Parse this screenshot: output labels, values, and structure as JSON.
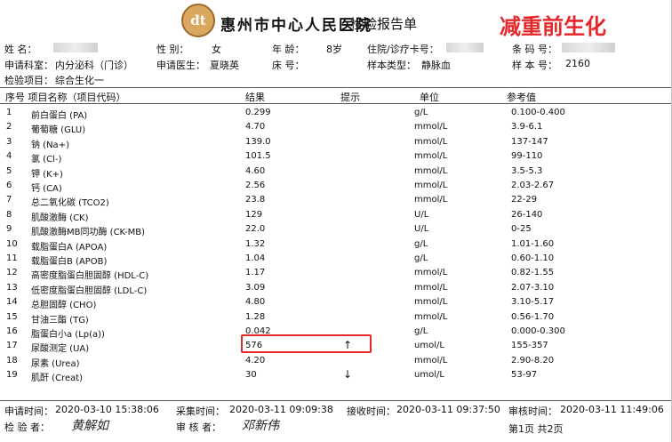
{
  "header": {
    "logo_text": "dt",
    "hospital": "惠州市中心人民医院",
    "report_type": "检验报告单",
    "tag": "减重前生化"
  },
  "patient": {
    "name_label": "姓    名：",
    "sex_label": "性    别：",
    "sex": "女",
    "age_label": "年    龄：",
    "age": "8岁",
    "admission_label": "住院/诊疗卡号：",
    "barcode_label": "条 码 号：",
    "department_label": "申请科室：",
    "department": "内分泌科（门诊）",
    "doctor_label": "申请医生：",
    "doctor": "夏晓英",
    "bed_label": "床    号：",
    "sample_type_label": "样本类型：",
    "sample_type": "静脉血",
    "sample_no_label": "样 本 号：",
    "sample_no": "2160",
    "test_item_label": "检验项目：",
    "test_item": "综合生化一"
  },
  "table": {
    "headers": {
      "no_name": "序号 项目名称（项目代码）",
      "result": "结果",
      "flag": "提示",
      "unit": "单位",
      "reference": "参考值"
    },
    "rows": [
      {
        "no": "1",
        "name": "前白蛋白 (PA)",
        "result": "0.299",
        "flag": "",
        "unit": "g/L",
        "ref": "0.100-0.400"
      },
      {
        "no": "2",
        "name": "葡萄糖 (GLU)",
        "result": "4.70",
        "flag": "",
        "unit": "mmol/L",
        "ref": "3.9-6.1"
      },
      {
        "no": "3",
        "name": "钠 (Na+)",
        "result": "139.0",
        "flag": "",
        "unit": "mmol/L",
        "ref": "137-147"
      },
      {
        "no": "4",
        "name": "氯 (Cl-)",
        "result": "101.5",
        "flag": "",
        "unit": "mmol/L",
        "ref": "99-110"
      },
      {
        "no": "5",
        "name": "钾 (K+)",
        "result": "4.60",
        "flag": "",
        "unit": "mmol/L",
        "ref": "3.5-5.3"
      },
      {
        "no": "6",
        "name": "钙 (CA)",
        "result": "2.56",
        "flag": "",
        "unit": "mmol/L",
        "ref": "2.03-2.67"
      },
      {
        "no": "7",
        "name": "总二氧化碳 (TCO2)",
        "result": "23.8",
        "flag": "",
        "unit": "mmol/L",
        "ref": "22-29"
      },
      {
        "no": "8",
        "name": "肌酸激酶 (CK)",
        "result": "129",
        "flag": "",
        "unit": "U/L",
        "ref": "26-140"
      },
      {
        "no": "9",
        "name": "肌酸激酶MB同功酶 (CK-MB)",
        "result": "22.0",
        "flag": "",
        "unit": "U/L",
        "ref": "0-25"
      },
      {
        "no": "10",
        "name": "载脂蛋白A (APOA)",
        "result": "1.32",
        "flag": "",
        "unit": "g/L",
        "ref": "1.01-1.60"
      },
      {
        "no": "11",
        "name": "载脂蛋白B (APOB)",
        "result": "1.04",
        "flag": "",
        "unit": "g/L",
        "ref": "0.60-1.10"
      },
      {
        "no": "12",
        "name": "高密度脂蛋白胆固醇 (HDL-C)",
        "result": "1.17",
        "flag": "",
        "unit": "mmol/L",
        "ref": "0.82-1.55"
      },
      {
        "no": "13",
        "name": "低密度脂蛋白胆固醇 (LDL-C)",
        "result": "3.09",
        "flag": "",
        "unit": "mmol/L",
        "ref": "2.07-3.10"
      },
      {
        "no": "14",
        "name": "总胆固醇 (CHO)",
        "result": "4.80",
        "flag": "",
        "unit": "mmol/L",
        "ref": "3.10-5.17"
      },
      {
        "no": "15",
        "name": "甘油三酯 (TG)",
        "result": "1.28",
        "flag": "",
        "unit": "mmol/L",
        "ref": "0.56-1.70"
      },
      {
        "no": "16",
        "name": "脂蛋白小a (Lp(a))",
        "result": "0.042",
        "flag": "",
        "unit": "g/L",
        "ref": "0.000-0.300"
      },
      {
        "no": "17",
        "name": "尿酸测定 (UA)",
        "result": "576",
        "flag": "↑",
        "unit": "umol/L",
        "ref": "155-357"
      },
      {
        "no": "18",
        "name": "尿素 (Urea)",
        "result": "4.20",
        "flag": "",
        "unit": "mmol/L",
        "ref": "2.90-8.20"
      },
      {
        "no": "19",
        "name": "肌酐 (Creat)",
        "result": "30",
        "flag": "↓",
        "unit": "umol/L",
        "ref": "53-97"
      }
    ]
  },
  "footer": {
    "apply_time_label": "申请时间：",
    "apply_time": "2020-03-10 15:38:06",
    "collect_time_label": "采集时间：",
    "collect_time": "2020-03-11 09:09:38",
    "receive_time_label": "接收时间：",
    "receive_time": "2020-03-11 09:37:50",
    "review_time_label": "审核时间：",
    "review_time": "2020-03-11 11:49:06",
    "tester_label": "检 验 者：",
    "tester_signature": "黄解如",
    "reviewer_label": "审 核 者：",
    "reviewer_signature": "邓新伟",
    "page": "第1页 共2页"
  },
  "colors": {
    "accent_red": "#e4282b"
  }
}
